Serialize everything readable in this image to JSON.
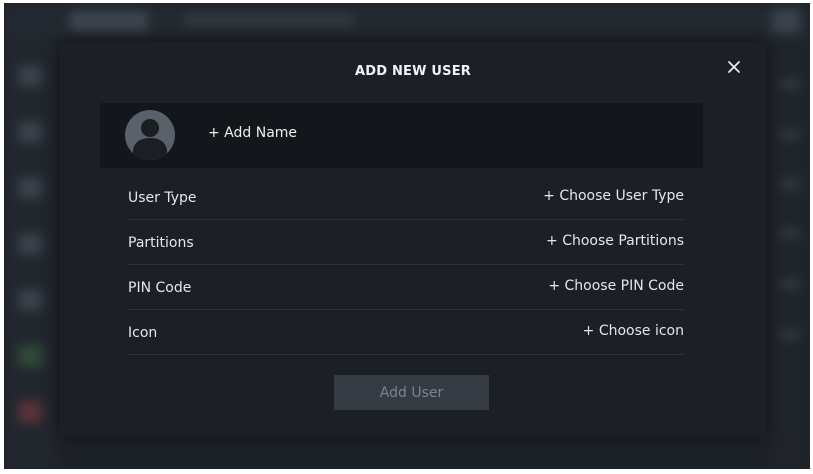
{
  "modal": {
    "title": "ADD NEW USER",
    "close_icon": "close-icon",
    "add_name_label": "+ Add Name",
    "avatar_icon": "user-avatar-icon",
    "fields": [
      {
        "label": "User Type",
        "action": "+ Choose User Type"
      },
      {
        "label": "Partitions",
        "action": "+ Choose Partitions"
      },
      {
        "label": "PIN Code",
        "action": "+ Choose PIN Code"
      },
      {
        "label": "Icon",
        "action": "+ Choose icon"
      }
    ],
    "submit_label": "Add User",
    "submit_disabled": true
  },
  "colors": {
    "backdrop": "#1d2228",
    "modal_bg": "#1c2026",
    "card_bg": "#13161a",
    "text": "#e4e7ea",
    "divider": "#2c3238",
    "button_bg": "#343b43",
    "button_text_disabled": "#7b838c"
  }
}
